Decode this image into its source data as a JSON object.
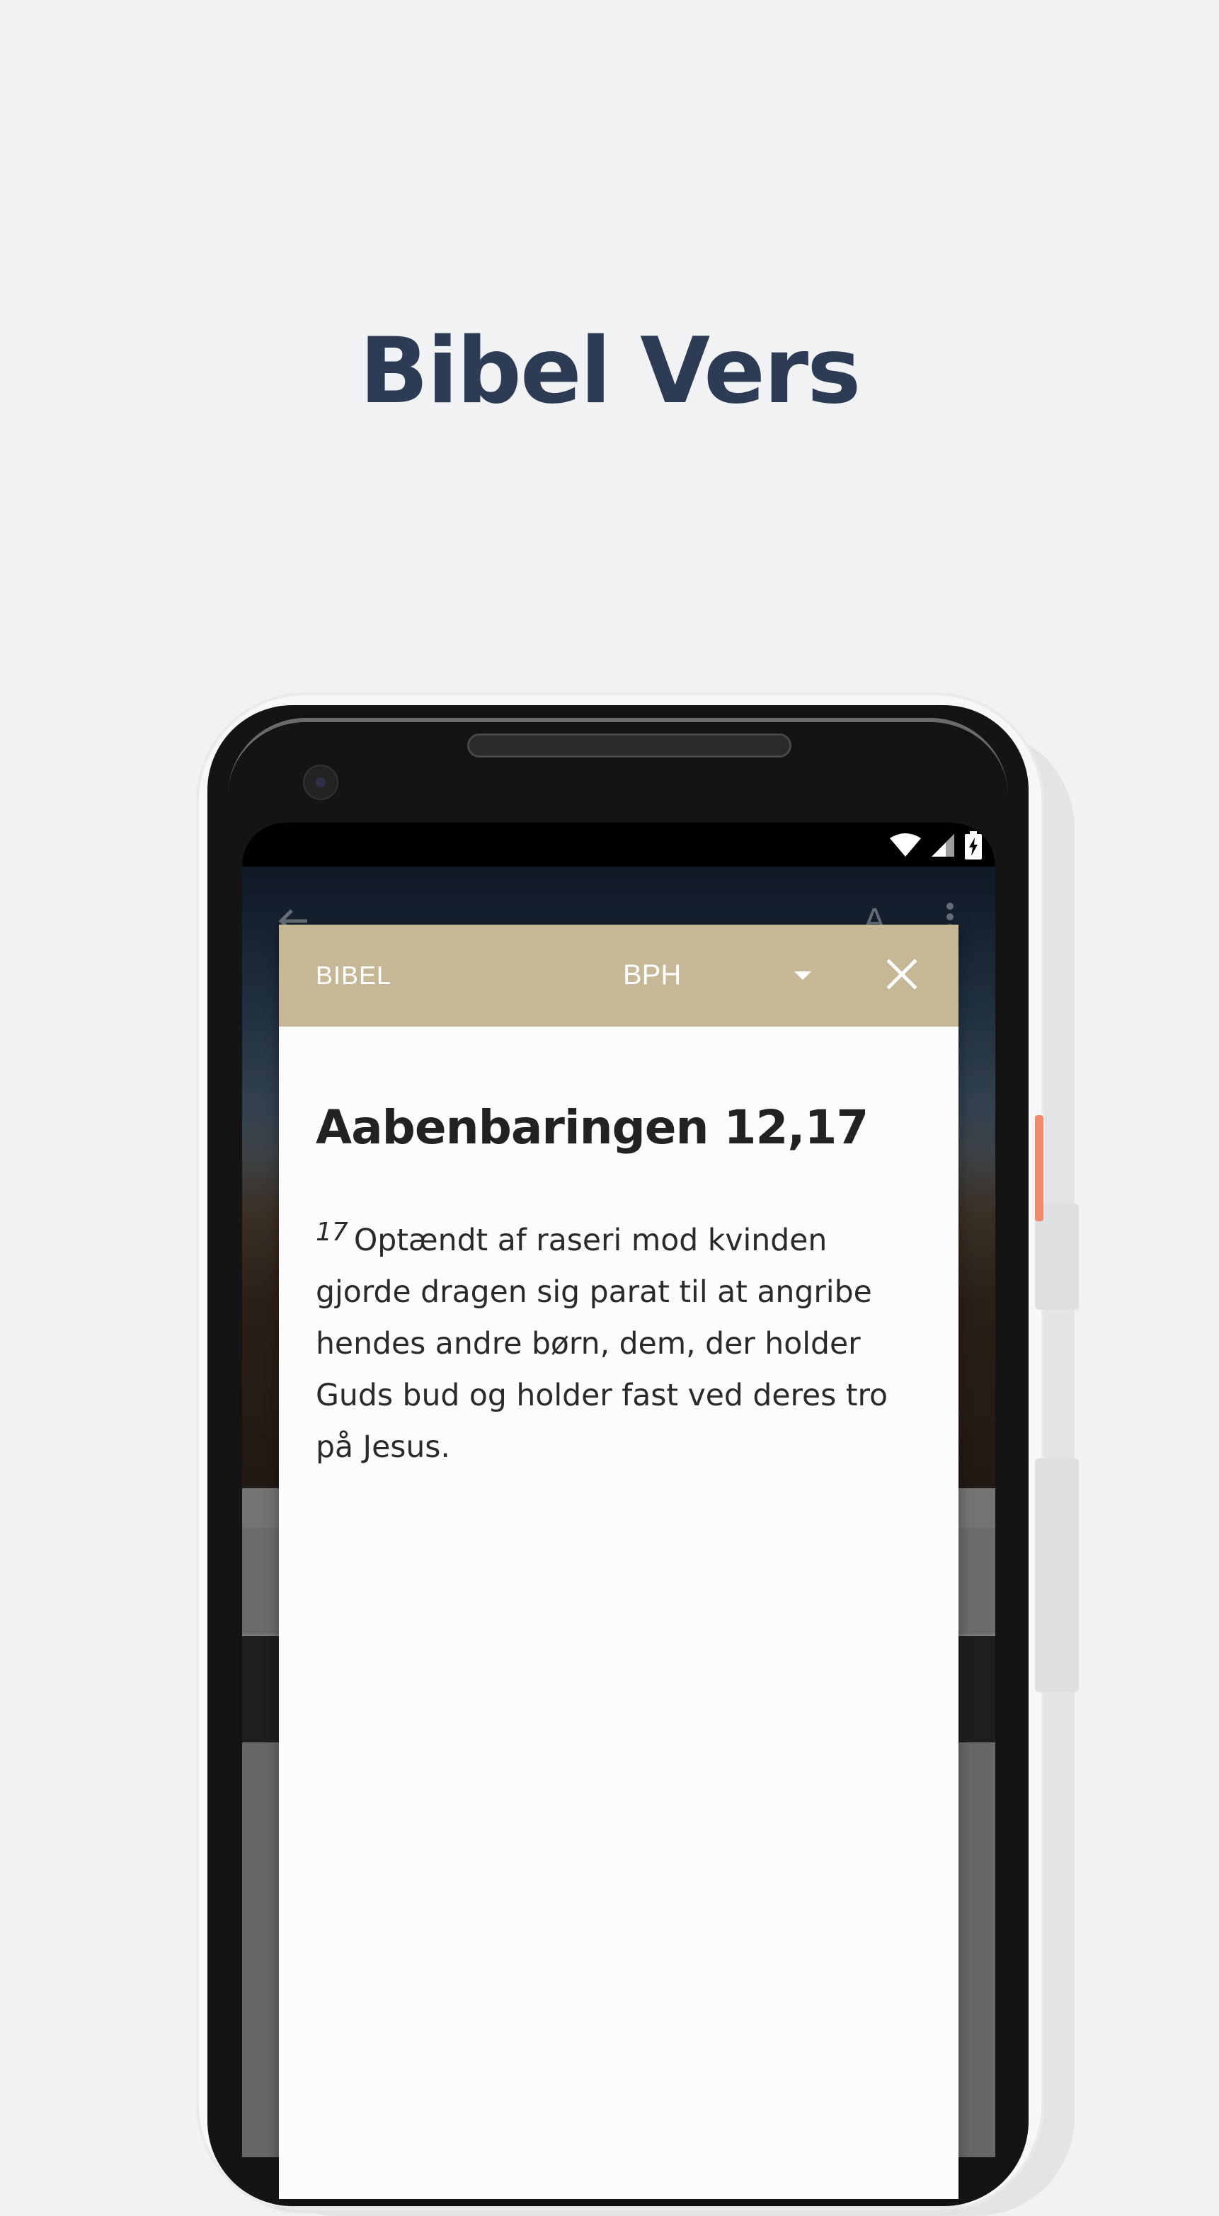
{
  "headline": "Bibel Vers",
  "modal": {
    "label": "BIBEL",
    "version": "BPH",
    "verse_reference": "Aabenbaringen 12,17",
    "verse_number": "17",
    "verse_text": "Optændt af raseri mod kvinden gjorde dragen sig parat til at angribe hendes andre børn, dem, der holder Guds bud og holder fast ved deres tro på Jesus."
  },
  "app_bar": {
    "font_icon_glyph": "A"
  },
  "icons": {
    "status": [
      "wifi-icon",
      "signal-icon",
      "battery-charging-icon"
    ],
    "app_bar": [
      "back-arrow-icon",
      "font-size-icon",
      "more-vert-icon"
    ],
    "modal": [
      "dropdown-caret-icon",
      "close-icon"
    ]
  },
  "colors": {
    "background": "#f1f2f4",
    "headline": "#2e3b55",
    "modal_header": "#c6b896",
    "modal_body": "#fcfcfc",
    "phone_accent": "#f08a6e"
  }
}
